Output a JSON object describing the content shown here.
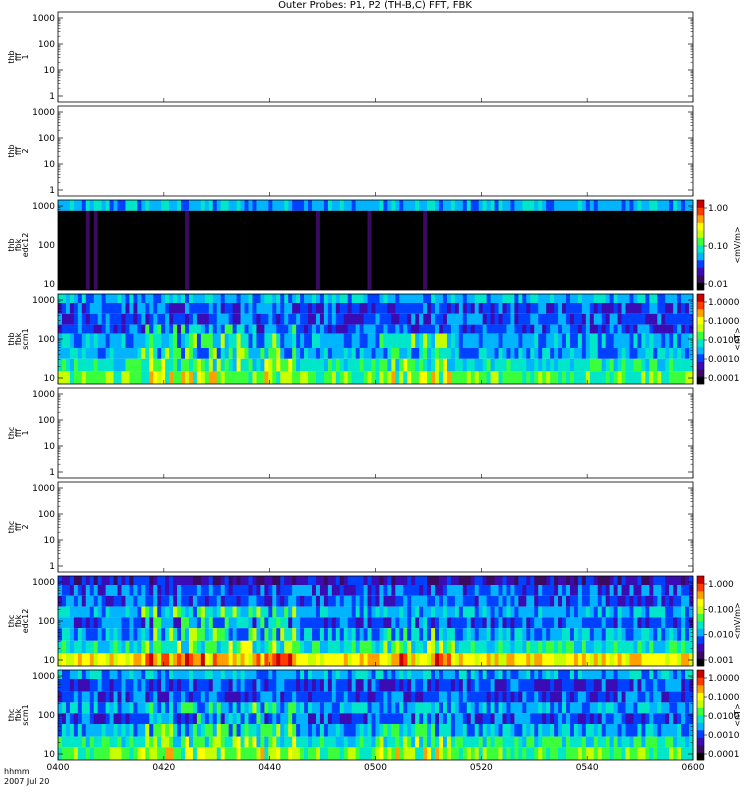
{
  "title": "Outer Probes: P1, P2 (TH-B,C) FFT, FBK",
  "x_axis": {
    "ticks": [
      "0400",
      "0420",
      "0440",
      "0500",
      "0520",
      "0540",
      "0600"
    ],
    "corner_label_1": "hhmm",
    "corner_label_2": "2007 Jul 20"
  },
  "colormap": [
    "#000000",
    "#3a0a60",
    "#3b0bb4",
    "#0040ff",
    "#00b4ff",
    "#00e6c8",
    "#3cff3c",
    "#c8ff00",
    "#ffff00",
    "#ffa000",
    "#ff3c00",
    "#c80000"
  ],
  "chart_data": [
    {
      "type": "heatmap",
      "ylabel": [
        "thb",
        "fff",
        "1"
      ],
      "ylim": [
        1,
        1000
      ],
      "y_scale": "log",
      "y_ticks": [
        "1000",
        "100",
        "10",
        "1"
      ],
      "empty": true
    },
    {
      "type": "heatmap",
      "ylabel": [
        "thb",
        "fff",
        "2"
      ],
      "ylim": [
        1,
        1000
      ],
      "y_scale": "log",
      "y_ticks": [
        "1000",
        "100",
        "10",
        "1"
      ],
      "empty": true
    },
    {
      "type": "heatmap",
      "ylabel": [
        "thb",
        "fbk",
        "edc12"
      ],
      "y_ticks": [
        "1000",
        "100",
        "10"
      ],
      "colorbar": {
        "label": "<mV/m>",
        "ticks": [
          "1.00",
          "0.10",
          "0.01"
        ]
      },
      "bands": [
        {
          "level": 4,
          "rows": 0.12
        },
        {
          "level": 0,
          "rows": 0.88
        }
      ]
    },
    {
      "type": "heatmap",
      "ylabel": [
        "thb",
        "fbk",
        "scm1"
      ],
      "y_ticks": [
        "1000",
        "100",
        "10"
      ],
      "colorbar": {
        "label": "<nT>",
        "ticks": [
          "1.0000",
          "0.1000",
          "0.0100",
          "0.0010",
          "0.0001"
        ]
      },
      "bands": [
        {
          "level": 4,
          "rows": 0.1
        },
        {
          "level": 3,
          "rows": 0.12
        },
        {
          "level": 3,
          "rows": 0.12
        },
        {
          "level": 3,
          "rows": 0.1
        },
        {
          "level": 4,
          "rows": 0.16
        },
        {
          "level": 4,
          "rows": 0.12
        },
        {
          "level": 5,
          "rows": 0.14
        },
        {
          "level": 6,
          "rows": 0.14
        }
      ]
    },
    {
      "type": "heatmap",
      "ylabel": [
        "thc",
        "fff",
        "1"
      ],
      "ylim": [
        1,
        1000
      ],
      "y_scale": "log",
      "y_ticks": [
        "1000",
        "100",
        "10",
        "1"
      ],
      "empty": true
    },
    {
      "type": "heatmap",
      "ylabel": [
        "thc",
        "fff",
        "2"
      ],
      "ylim": [
        1,
        1000
      ],
      "y_scale": "log",
      "y_ticks": [
        "1000",
        "100",
        "10",
        "1"
      ],
      "empty": true
    },
    {
      "type": "heatmap",
      "ylabel": [
        "thc",
        "fbk",
        "edc12"
      ],
      "y_ticks": [
        "1000",
        "100",
        "10"
      ],
      "colorbar": {
        "label": "<mV/m>",
        "ticks": [
          "1.000",
          "0.100",
          "0.010",
          "0.001"
        ]
      },
      "bands": [
        {
          "level": 2,
          "rows": 0.1
        },
        {
          "level": 3,
          "rows": 0.12
        },
        {
          "level": 3,
          "rows": 0.12
        },
        {
          "level": 4,
          "rows": 0.12
        },
        {
          "level": 3,
          "rows": 0.12
        },
        {
          "level": 4,
          "rows": 0.14
        },
        {
          "level": 5,
          "rows": 0.14
        },
        {
          "level": 8,
          "rows": 0.14
        }
      ]
    },
    {
      "type": "heatmap",
      "ylabel": [
        "thc",
        "fbk",
        "scm1"
      ],
      "y_ticks": [
        "1000",
        "100",
        "10"
      ],
      "colorbar": {
        "label": "<nT>",
        "ticks": [
          "1.0000",
          "0.1000",
          "0.0100",
          "0.0010",
          "0.0001"
        ]
      },
      "bands": [
        {
          "level": 4,
          "rows": 0.1
        },
        {
          "level": 3,
          "rows": 0.14
        },
        {
          "level": 3,
          "rows": 0.12
        },
        {
          "level": 4,
          "rows": 0.12
        },
        {
          "level": 3,
          "rows": 0.12
        },
        {
          "level": 4,
          "rows": 0.14
        },
        {
          "level": 5,
          "rows": 0.12
        },
        {
          "level": 6,
          "rows": 0.14
        }
      ]
    }
  ]
}
